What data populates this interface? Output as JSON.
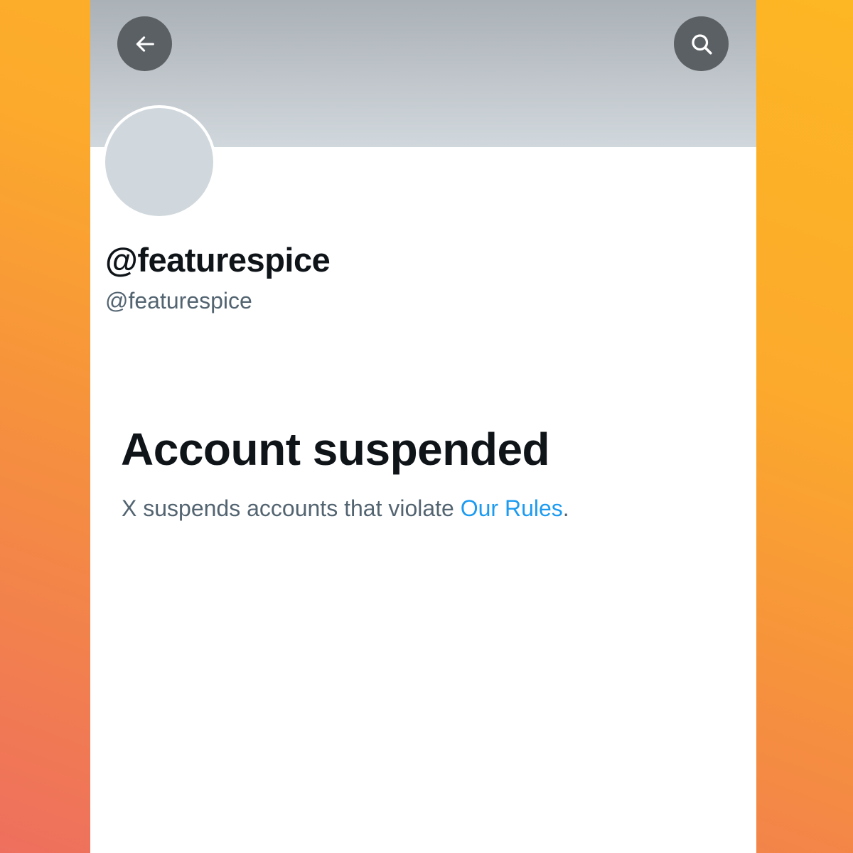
{
  "header": {
    "back_icon": "arrow-left-icon",
    "search_icon": "search-icon"
  },
  "profile": {
    "display_name": "@featurespice",
    "handle": "@featurespice"
  },
  "suspension": {
    "title": "Account suspended",
    "description_prefix": "X suspends accounts that violate ",
    "link_text": "Our Rules",
    "description_suffix": "."
  },
  "colors": {
    "link": "#1d9bf0",
    "primary_text": "#0f1419",
    "secondary_text": "#536471",
    "button_bg": "#5b6064"
  }
}
